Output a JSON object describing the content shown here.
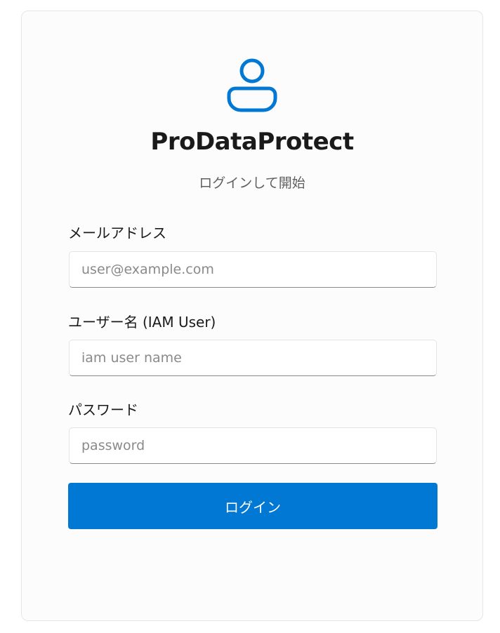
{
  "app": {
    "title": "ProDataProtect",
    "subtitle": "ログインして開始",
    "accent_color": "#0078d4",
    "icon": "user-avatar-icon"
  },
  "form": {
    "email": {
      "label": "メールアドレス",
      "placeholder": "user@example.com",
      "value": ""
    },
    "username": {
      "label": "ユーザー名 (IAM User)",
      "placeholder": "iam user name",
      "value": ""
    },
    "password": {
      "label": "パスワード",
      "placeholder": "password",
      "value": ""
    },
    "submit_label": "ログイン"
  }
}
